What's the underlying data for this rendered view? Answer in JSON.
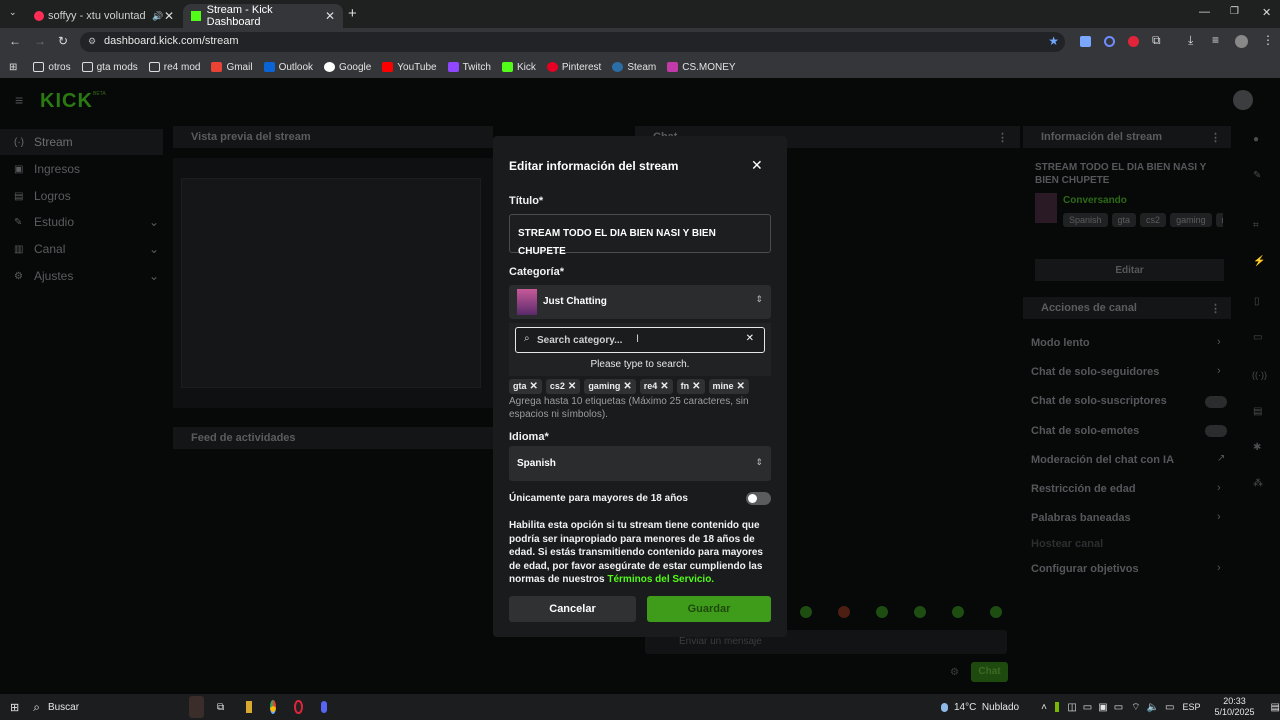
{
  "browser": {
    "tabs": [
      {
        "title": "soffyy - xtu voluntad (Vide",
        "active": false
      },
      {
        "title": "Stream - Kick Dashboard",
        "active": true
      }
    ],
    "new_tab": "+",
    "url": "dashboard.kick.com/stream",
    "bookmarks": [
      "otros",
      "gta mods",
      "re4 mod",
      "Gmail",
      "Outlook",
      "Google",
      "YouTube",
      "Twitch",
      "Kick",
      "Pinterest",
      "Steam",
      "CS.MONEY"
    ]
  },
  "kick": {
    "logo": "KICK",
    "beta": "BETA",
    "sidebar": [
      {
        "label": "Stream",
        "icon": "stream-icon",
        "expandable": false
      },
      {
        "label": "Ingresos",
        "icon": "revenue-icon",
        "expandable": false
      },
      {
        "label": "Logros",
        "icon": "achievements-icon",
        "expandable": false
      },
      {
        "label": "Estudio",
        "icon": "studio-icon",
        "expandable": true
      },
      {
        "label": "Canal",
        "icon": "channel-icon",
        "expandable": true
      },
      {
        "label": "Ajustes",
        "icon": "settings-icon",
        "expandable": true
      }
    ],
    "preview_title": "Vista previa del stream",
    "activity_title": "Feed de actividades",
    "chat_title": "Chat",
    "chat_placeholder": "Enviar un mensaje",
    "chat_button": "Chat",
    "info_panel": {
      "title": "Información del stream",
      "stream_title": "STREAM TODO EL DIA BIEN NASI Y BIEN CHUPETE",
      "category": "Conversando",
      "tags": [
        "Spanish",
        "gta",
        "cs2",
        "gaming",
        "re"
      ],
      "edit": "Editar"
    },
    "actions_panel": {
      "title": "Acciones de canal",
      "items": [
        "Modo lento",
        "Chat de solo-seguidores",
        "Chat de solo-suscriptores",
        "Chat de solo-emotes",
        "Moderación del chat con IA",
        "Restricción de edad",
        "Palabras baneadas",
        "Hostear canal",
        "Configurar objetivos"
      ]
    }
  },
  "modal": {
    "title": "Editar información del stream",
    "title_label": "Título*",
    "title_value": "STREAM TODO EL DIA BIEN NASI Y BIEN CHUPETE",
    "category_label": "Categoría*",
    "category_value": "Just Chatting",
    "search_placeholder": "Search category...",
    "search_hint": "Please type to search.",
    "tags": [
      "gta",
      "cs2",
      "gaming",
      "re4",
      "fn",
      "mine"
    ],
    "tags_help": "Agrega hasta 10 etiquetas (Máximo 25 caracteres, sin espacios ni símbolos).",
    "language_label": "Idioma*",
    "language_value": "Spanish",
    "adult_label": "Únicamente para mayores de 18 años",
    "adult_enabled": false,
    "adult_help": "Habilita esta opción si tu stream tiene contenido que podría ser inapropiado para menores de 18 años de edad. Si estás transmitiendo contenido para mayores de edad, por favor asegúrate de estar cumpliendo las normas de nuestros",
    "terms_link": "Términos del Servicio.",
    "cancel": "Cancelar",
    "save": "Guardar"
  },
  "taskbar": {
    "search": "Buscar",
    "weather": "14°C  Nublado",
    "lang": "ESP",
    "time": "20:33",
    "date": "5/10/2025"
  },
  "colors": {
    "kick_green": "#53fc18",
    "save_green": "#3f9c1a",
    "terms_green": "#53fc18"
  }
}
